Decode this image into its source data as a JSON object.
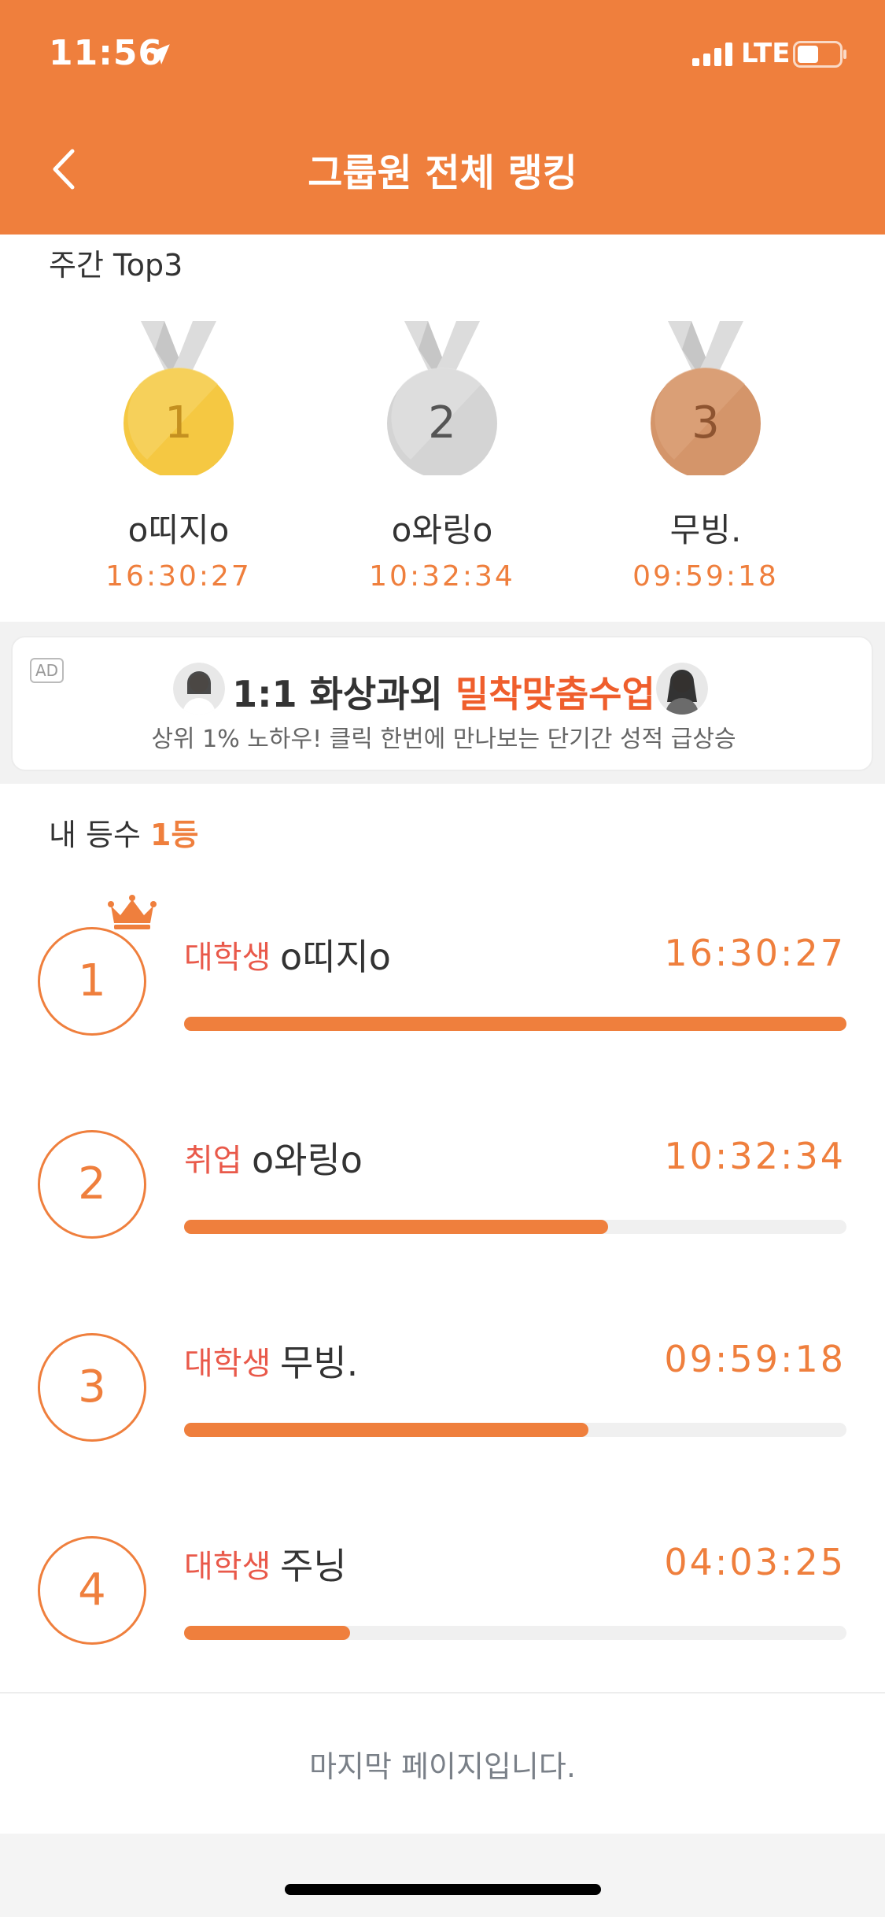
{
  "status_bar": {
    "time": "11:56",
    "network": "LTE"
  },
  "header": {
    "title": "그룹원 전체 랭킹",
    "back_icon": "chevron-left-icon"
  },
  "top3": {
    "label": "주간 Top3",
    "medals": [
      {
        "rank": "1",
        "name": "o띠지o",
        "time": "16:30:27",
        "color": "#F5C842"
      },
      {
        "rank": "2",
        "name": "o와링o",
        "time": "10:32:34",
        "color": "#D4D4D4"
      },
      {
        "rank": "3",
        "name": "무빙.",
        "time": "09:59:18",
        "color": "#D4956A"
      }
    ]
  },
  "ad": {
    "badge": "AD",
    "title_plain": "1:1 화상과외 ",
    "title_highlight": "밀착맞춤수업",
    "subtitle": "상위 1% 노하우! 클릭 한번에 만나보는 단기간 성적 급상승"
  },
  "my_rank": {
    "label": "내 등수 ",
    "value": "1등"
  },
  "ranking": [
    {
      "rank": "1",
      "category": "대학생",
      "name": "o띠지o",
      "time": "16:30:27",
      "progress": 1.0,
      "crown": true
    },
    {
      "rank": "2",
      "category": "취업",
      "name": "o와링o",
      "time": "10:32:34",
      "progress": 0.64
    },
    {
      "rank": "3",
      "category": "대학생",
      "name": "무빙.",
      "time": "09:59:18",
      "progress": 0.61
    },
    {
      "rank": "4",
      "category": "대학생",
      "name": "주닝",
      "time": "04:03:25",
      "progress": 0.25
    }
  ],
  "footer": {
    "text": "마지막 페이지입니다."
  },
  "colors": {
    "accent": "#EF7F3D",
    "category": "#E9594A",
    "ad_highlight": "#EF5E2C"
  }
}
